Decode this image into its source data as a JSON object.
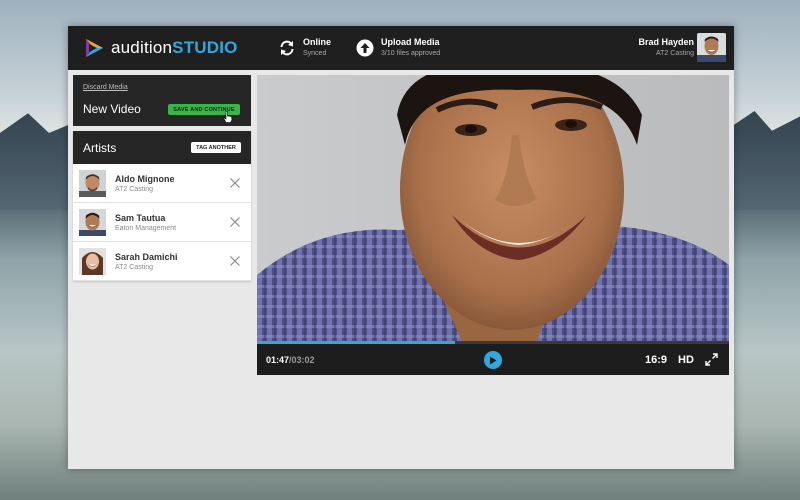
{
  "app": {
    "logo_prefix": "audition",
    "logo_suffix": "STUDIO",
    "accent_color": "#2fa8e0",
    "save_color": "#3bb34a"
  },
  "header": {
    "sync": {
      "title": "Online",
      "subtitle": "Synced",
      "icon": "sync-icon"
    },
    "upload": {
      "title": "Upload Media",
      "subtitle": "3/10 files approved",
      "icon": "upload-icon"
    },
    "user": {
      "name": "Brad Hayden",
      "company": "AT2 Casting"
    }
  },
  "new_video_panel": {
    "discard_label": "Discard Media",
    "title": "New Video",
    "save_label": "SAVE AND CONTINUE"
  },
  "artists_panel": {
    "title": "Artists",
    "tag_label": "TAG ANOTHER",
    "items": [
      {
        "name": "Aldo Mignone",
        "agency": "AT2 Casting"
      },
      {
        "name": "Sam Tautua",
        "agency": "Eaton Management"
      },
      {
        "name": "Sarah Damichi",
        "agency": "AT2 Casting"
      }
    ]
  },
  "player": {
    "current_time": "01:47",
    "separator": "/",
    "duration": "03:02",
    "progress_fraction": 0.42,
    "aspect_ratio": "16:9",
    "quality": "HD"
  }
}
